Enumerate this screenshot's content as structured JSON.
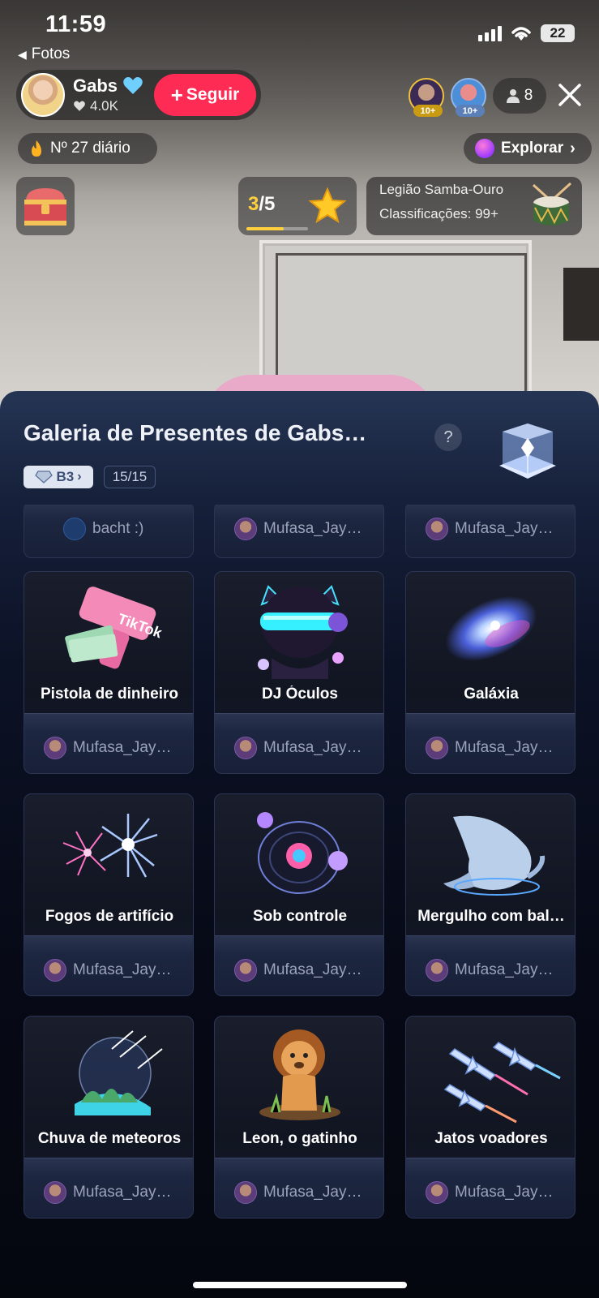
{
  "status": {
    "time": "11:59",
    "battery": "22",
    "back_app": "Fotos"
  },
  "host": {
    "name": "Gabs",
    "likes": "4.0K",
    "follow_label": "Seguir"
  },
  "viewers": {
    "badge_1": "10+",
    "badge_2": "10+",
    "count": "8"
  },
  "daily_rank": "Nº 27 diário",
  "explore_label": "Explorar",
  "progress": {
    "current": "3",
    "total": "/5",
    "fraction": 0.6
  },
  "legion": {
    "title": "Legião Samba-Ouro",
    "rank": "Classificações: 99+"
  },
  "gallery": {
    "title": "Galeria de Presentes de Gabs…",
    "help": "?",
    "level": "B3",
    "count": "15/15",
    "partial_senders": [
      "bacht :)",
      "Mufasa_Jay…",
      "Mufasa_Jay…"
    ],
    "gifts": [
      {
        "name": "Pistola de dinheiro",
        "sender": "Mufasa_Jay…",
        "icon": "money-gun-icon"
      },
      {
        "name": "DJ Óculos",
        "sender": "Mufasa_Jay…",
        "icon": "dj-glasses-icon"
      },
      {
        "name": "Galáxia",
        "sender": "Mufasa_Jay…",
        "icon": "galaxy-icon"
      },
      {
        "name": "Fogos de artifício",
        "sender": "Mufasa_Jay…",
        "icon": "fireworks-icon"
      },
      {
        "name": "Sob controle",
        "sender": "Mufasa_Jay…",
        "icon": "vinyl-record-icon"
      },
      {
        "name": "Mergulho com bal…",
        "sender": "Mufasa_Jay…",
        "icon": "whale-icon"
      },
      {
        "name": "Chuva de meteoros",
        "sender": "Mufasa_Jay…",
        "icon": "meteor-shower-icon"
      },
      {
        "name": "Leon, o gatinho",
        "sender": "Mufasa_Jay…",
        "icon": "lion-cub-icon"
      },
      {
        "name": "Jatos voadores",
        "sender": "Mufasa_Jay…",
        "icon": "jets-icon"
      }
    ]
  }
}
